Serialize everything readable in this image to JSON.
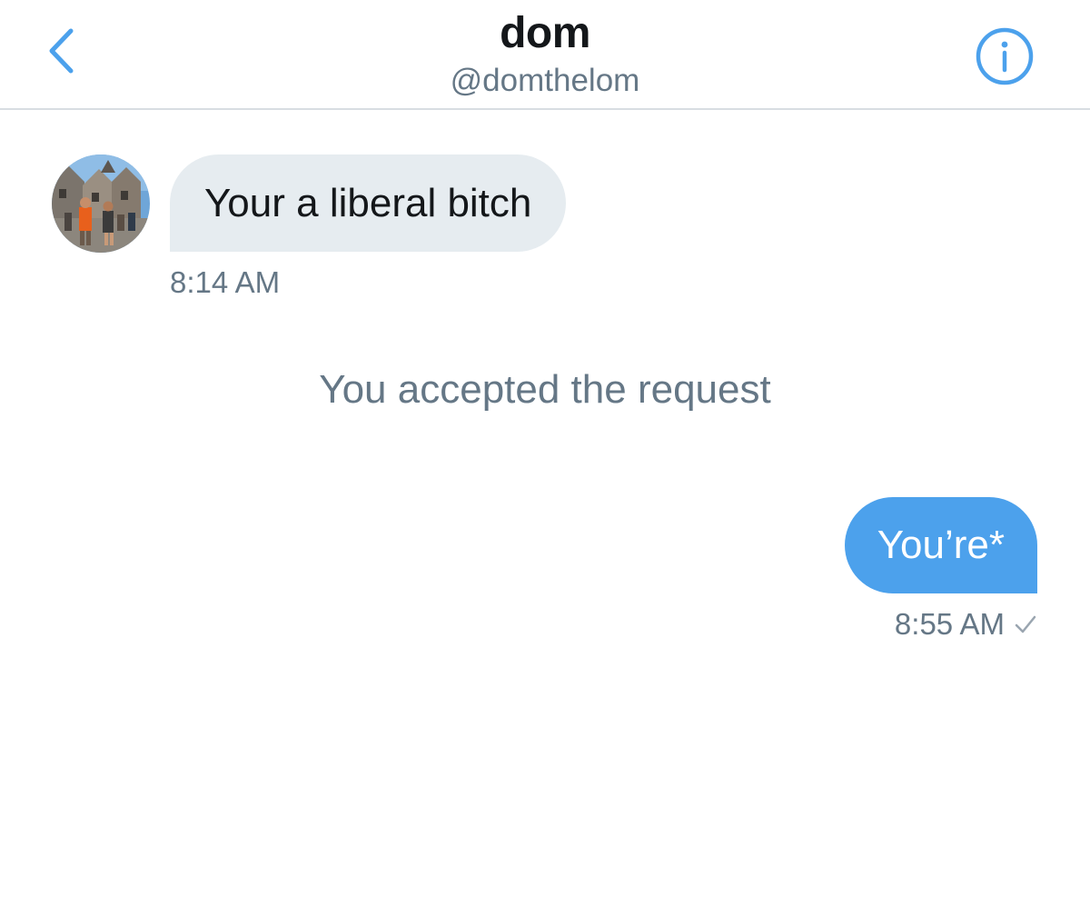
{
  "header": {
    "title": "dom",
    "handle": "@domthelom",
    "back_icon": "chevron-left-icon",
    "info_icon": "info-icon"
  },
  "conversation": {
    "incoming": {
      "avatar": "avatar-photo",
      "text": "Your a liberal bitch",
      "time": "8:14 AM"
    },
    "system_message": "You accepted the request",
    "outgoing": {
      "text": "You’re*",
      "time": "8:55 AM",
      "status_icon": "check-icon"
    }
  },
  "colors": {
    "accent": "#4ca1ec",
    "incoming_bubble": "#e6ecf0",
    "secondary_text": "#657786",
    "primary_text": "#14171a"
  }
}
